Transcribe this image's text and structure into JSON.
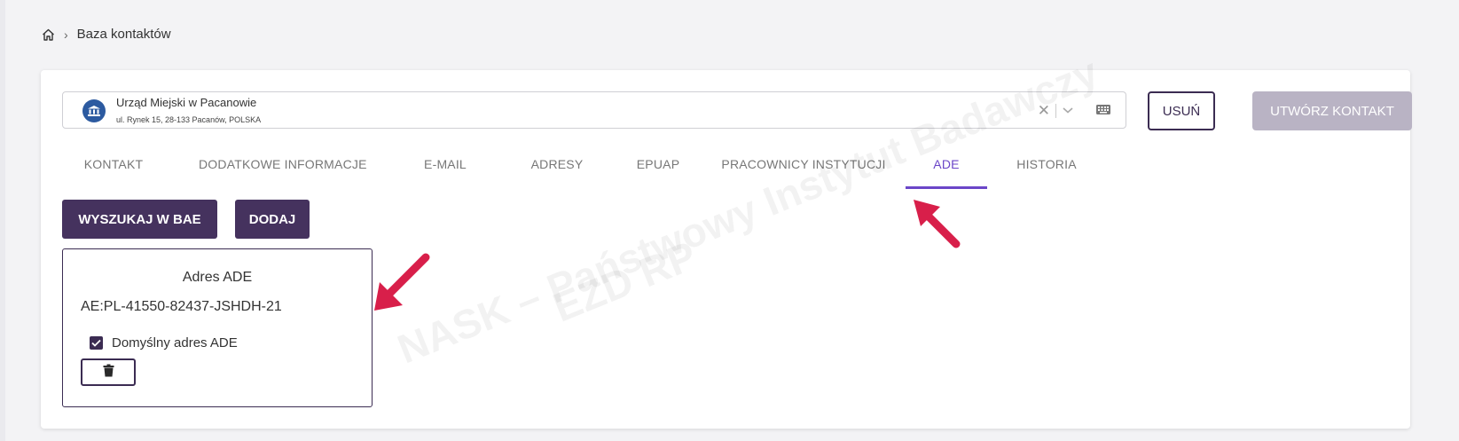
{
  "breadcrumb": {
    "current": "Baza kontaktów",
    "separator": "›"
  },
  "institution": {
    "name": "Urząd Miejski w Pacanowie",
    "address": "ul. Rynek 15, 28-133 Pacanów, POLSKA",
    "clear_symbol": "✕",
    "dropdown_symbol": "⌄"
  },
  "buttons": {
    "delete": "USUŃ",
    "create": "UTWÓRZ KONTAKT",
    "search_bae": "WYSZUKAJ W BAE",
    "add": "DODAJ"
  },
  "tabs": [
    {
      "label": "KONTAKT",
      "active": false
    },
    {
      "label": "DODATKOWE INFORMACJE",
      "active": false
    },
    {
      "label": "E-MAIL",
      "active": false
    },
    {
      "label": "ADRESY",
      "active": false
    },
    {
      "label": "EPUAP",
      "active": false
    },
    {
      "label": "PRACOWNICY INSTYTUCJI",
      "active": false
    },
    {
      "label": "ADE",
      "active": true
    },
    {
      "label": "HISTORIA",
      "active": false
    }
  ],
  "ade": {
    "title": "Adres ADE",
    "value": "AE:PL-41550-82437-JSHDH-21",
    "default_label": "Domyślny adres ADE",
    "default_checked": true
  },
  "watermark": {
    "text": "NASK – Państwowy Instytut Badawczy",
    "logo": "EZD RP"
  },
  "colors": {
    "accent": "#6b46c8",
    "dark_button": "#45325e",
    "disabled_button": "#b9b3c4",
    "arrow": "#d81f4a"
  }
}
